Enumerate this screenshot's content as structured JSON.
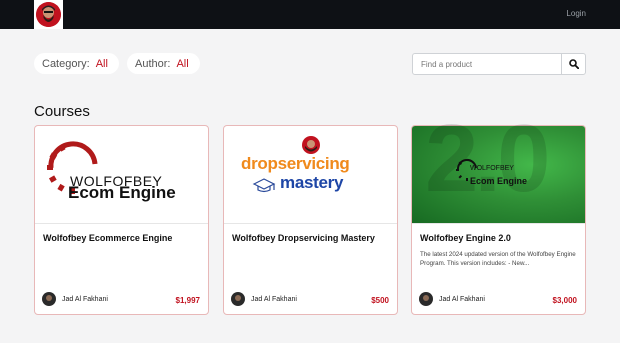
{
  "header": {
    "login_label": "Login"
  },
  "filters": {
    "category": {
      "label": "Category:",
      "value": "All"
    },
    "author": {
      "label": "Author:",
      "value": "All"
    }
  },
  "search": {
    "placeholder": "Find a product"
  },
  "section_title": "Courses",
  "courses": [
    {
      "title": "Wolfofbey Ecommerce Engine",
      "description": "",
      "author": "Jad Al Fakhani",
      "price": "$1,997",
      "thumb_text": {
        "brand": "WOLFOFBEY",
        "product": "Ecom Engine"
      }
    },
    {
      "title": "Wolfofbey Dropservicing Mastery",
      "description": "",
      "author": "Jad Al Fakhani",
      "price": "$500",
      "thumb_text": {
        "line1": "dropservicing",
        "line2": "mastery"
      }
    },
    {
      "title": "Wolfofbey Engine 2.0",
      "description": "The latest 2024 updated version of the Wolfofbey Engine Program. This version includes: - New...",
      "author": "Jad Al Fakhani",
      "price": "$3,000",
      "thumb_text": {
        "big": "2.0",
        "brand": "WOLFOFBEY",
        "product": "Ecom Engine"
      }
    }
  ],
  "colors": {
    "accent": "#c1121f",
    "topbar": "#0e1115",
    "background": "#f4f4f5"
  },
  "icons": {
    "search": "search-icon",
    "logo": "logo-avatar-icon"
  }
}
